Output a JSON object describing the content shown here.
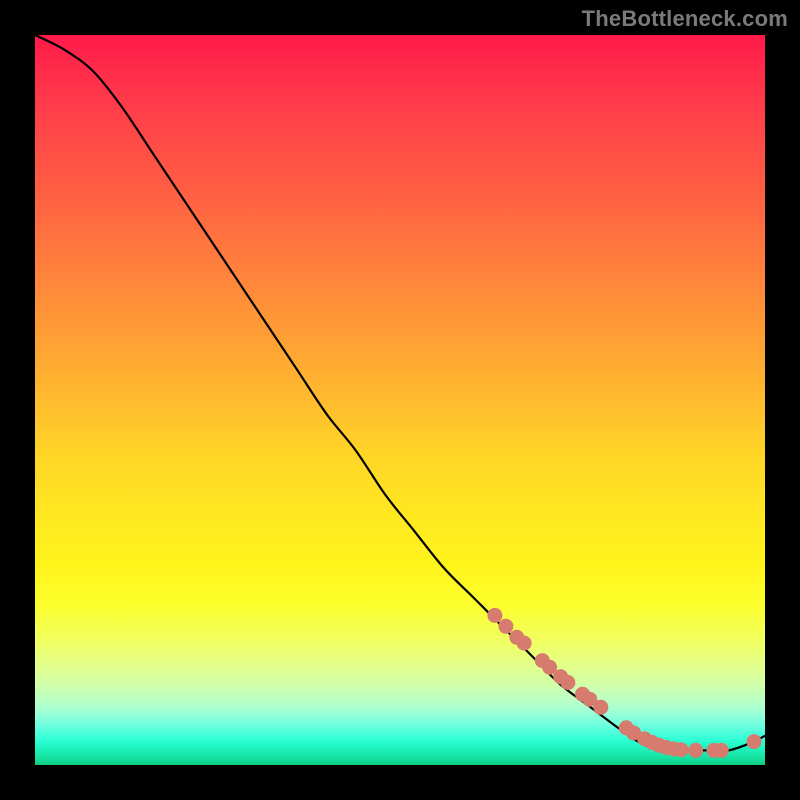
{
  "attribution": "TheBottleneck.com",
  "chart_data": {
    "type": "line",
    "title": "",
    "xlabel": "",
    "ylabel": "",
    "xlim": [
      0,
      100
    ],
    "ylim": [
      0,
      100
    ],
    "grid": false,
    "legend": false,
    "series": [
      {
        "name": "curve",
        "x": [
          0,
          4,
          8,
          12,
          16,
          20,
          24,
          28,
          32,
          36,
          40,
          44,
          48,
          52,
          56,
          60,
          64,
          68,
          72,
          76,
          80,
          83,
          86,
          89,
          92,
          95,
          98,
          100
        ],
        "y": [
          100,
          98,
          95,
          90,
          84,
          78,
          72,
          66,
          60,
          54,
          48,
          43,
          37,
          32,
          27,
          23,
          19,
          15,
          11,
          8,
          5,
          3,
          2,
          2,
          2,
          2,
          3,
          4
        ]
      },
      {
        "name": "dots",
        "mode": "markers",
        "x": [
          63,
          64.5,
          66,
          67,
          69.5,
          70.5,
          72,
          73,
          75,
          76,
          77.5,
          81,
          82,
          83.5,
          84.5,
          85.5,
          86.5,
          87.5,
          88.5,
          90.5,
          93,
          94,
          98.5
        ],
        "y": [
          20.5,
          19,
          17.5,
          16.7,
          14.3,
          13.4,
          12.1,
          11.3,
          9.7,
          9.0,
          7.9,
          5.1,
          4.4,
          3.6,
          3.1,
          2.7,
          2.4,
          2.2,
          2.1,
          2.0,
          2.0,
          2.0,
          3.2
        ]
      }
    ],
    "marker_radius_px": 7,
    "curve_color": "#000000",
    "marker_color": "#d77b6f"
  }
}
